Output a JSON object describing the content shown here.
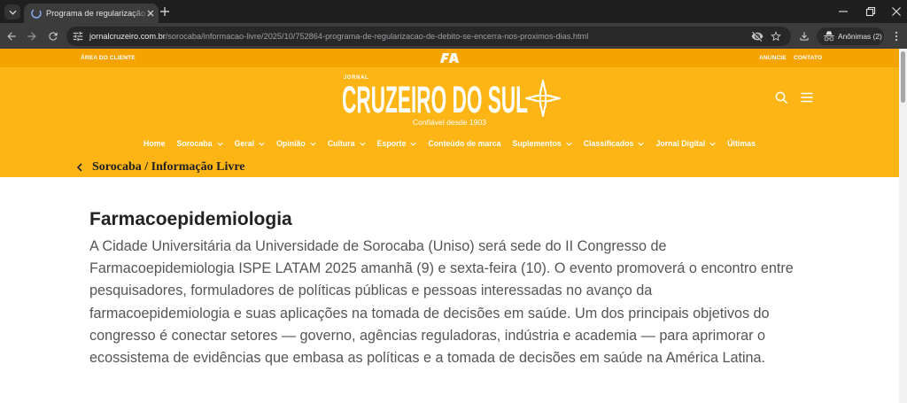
{
  "browser": {
    "tab_title": "Programa de regularização de",
    "url_domain": "jornalcruzeiro.com.br",
    "url_path": "/sorocaba/informacao-livre/2025/10/752864-programa-de-regularizacao-de-debito-se-encerra-nos-proximos-dias.html",
    "profile_label": "Anônimas (2)",
    "icons": [
      "tab-search-chevron-icon",
      "favicon-icon",
      "tab-close-icon",
      "new-tab-plus-icon",
      "minimize-icon",
      "restore-icon",
      "close-window-icon",
      "back-arrow-icon",
      "forward-arrow-icon",
      "reload-icon",
      "site-settings-icon",
      "eye-off-icon",
      "bookmark-star-icon",
      "download-icon",
      "incognito-icon",
      "kebab-menu-icon"
    ]
  },
  "site": {
    "topbar": {
      "client_area": "ÁREA DO CLIENTE",
      "advertise": "ANUNCIE",
      "contact": "CONTATO"
    },
    "logo": {
      "small": "JORNAL",
      "main": "CRUZEIRO DO SUL",
      "tagline": "Confiável desde 1903"
    },
    "header_icons": [
      "search-icon",
      "hamburger-menu-icon",
      "logo-star-icon"
    ],
    "nav": [
      {
        "label": "Home",
        "dropdown": false
      },
      {
        "label": "Sorocaba",
        "dropdown": true
      },
      {
        "label": "Geral",
        "dropdown": true
      },
      {
        "label": "Opinião",
        "dropdown": true
      },
      {
        "label": "Cultura",
        "dropdown": true
      },
      {
        "label": "Esporte",
        "dropdown": true
      },
      {
        "label": "Conteúdo de marca",
        "dropdown": false
      },
      {
        "label": "Suplementos",
        "dropdown": true
      },
      {
        "label": "Classificados",
        "dropdown": true
      },
      {
        "label": "Jornal Digital",
        "dropdown": true
      },
      {
        "label": "Últimas",
        "dropdown": false
      }
    ],
    "breadcrumb": "Sorocaba / Informação Livre"
  },
  "article": {
    "heading": "Farmacoepidemiologia",
    "paragraph_lines": [
      "A Cidade Universitária da Universidade de Sorocaba (Uniso) será sede do II Congresso de",
      "Farmacoepidemiologia ISPE LATAM 2025 amanhã (9) e sexta-feira (10). O evento promoverá o encontro entre",
      "pesquisadores, formuladores de políticas públicas e pessoas interessadas no avanço da",
      "farmacoepidemiologia e suas aplicações na tomada de decisões em saúde. Um dos principais objetivos do",
      "congresso é conectar setores — governo, agências reguladoras, indústria e academia — para aprimorar o",
      "ecossistema de evidências que embasa as políticas e a tomada de decisões em saúde na América Latina."
    ]
  },
  "colors": {
    "brand_yellow": "#FDB515",
    "topbar_orange": "#F5A300",
    "heading_text": "#222222",
    "body_text": "#555555",
    "browser_frame": "#1F1F1F",
    "browser_toolbar": "#3C3C3C"
  }
}
